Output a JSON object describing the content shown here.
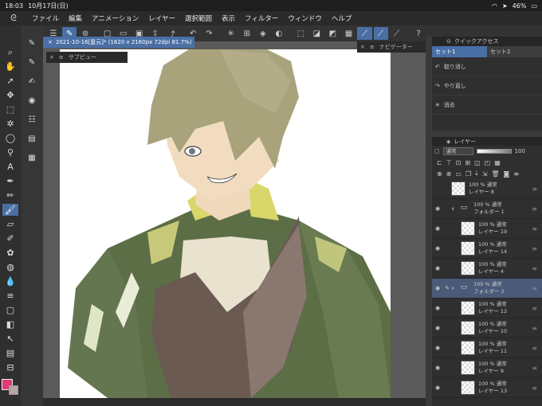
{
  "status": {
    "time": "18:03",
    "date": "10月17日(日)",
    "battery": "46%"
  },
  "menu": [
    "ファイル",
    "編集",
    "アニメーション",
    "レイヤー",
    "選択範囲",
    "表示",
    "フィルター",
    "ウィンドウ",
    "ヘルプ"
  ],
  "document_tab": "2021-10-16[复元]* (1620 x 2160px 72dpi 81.7%)",
  "subview_label": "サブビュー",
  "navigator_label": "ナビゲーター",
  "quick_access": {
    "title": "クイックアクセス",
    "sets": [
      "セット1",
      "セット2"
    ],
    "items": [
      "取り消し",
      "やり直し",
      "消去"
    ]
  },
  "layer_panel": {
    "title": "レイヤー",
    "blend_mode": "通常",
    "opacity": "100",
    "layers": [
      {
        "pct": "100 % 通常",
        "name": "レイヤー 8",
        "type": "layer",
        "depth": 0,
        "visible": false,
        "selected": false
      },
      {
        "pct": "100 % 通常",
        "name": "フォルダー 1",
        "type": "folder",
        "depth": 0,
        "visible": true,
        "selected": false
      },
      {
        "pct": "100 % 通常",
        "name": "レイヤー 19",
        "type": "layer",
        "depth": 1,
        "visible": true,
        "selected": false
      },
      {
        "pct": "100 % 通常",
        "name": "レイヤー 14",
        "type": "layer",
        "depth": 1,
        "visible": true,
        "selected": false
      },
      {
        "pct": "100 % 通常",
        "name": "レイヤー 4",
        "type": "layer",
        "depth": 1,
        "visible": true,
        "selected": false
      },
      {
        "pct": "100 % 通常",
        "name": "フォルダー 2",
        "type": "folder",
        "depth": 0,
        "visible": true,
        "selected": true
      },
      {
        "pct": "100 % 通常",
        "name": "レイヤー 12",
        "type": "layer",
        "depth": 1,
        "visible": true,
        "selected": false
      },
      {
        "pct": "100 % 通常",
        "name": "レイヤー 10",
        "type": "layer",
        "depth": 1,
        "visible": true,
        "selected": false
      },
      {
        "pct": "100 % 通常",
        "name": "レイヤー 11",
        "type": "layer",
        "depth": 1,
        "visible": true,
        "selected": false
      },
      {
        "pct": "100 % 通常",
        "name": "レイヤー 9",
        "type": "layer",
        "depth": 1,
        "visible": true,
        "selected": false
      },
      {
        "pct": "100 % 通常",
        "name": "レイヤー 13",
        "type": "layer",
        "depth": 1,
        "visible": true,
        "selected": false
      }
    ]
  },
  "colors": {
    "main": "#e03a78",
    "sub": "#b9a3a3",
    "accent": "#4a6fa5"
  }
}
